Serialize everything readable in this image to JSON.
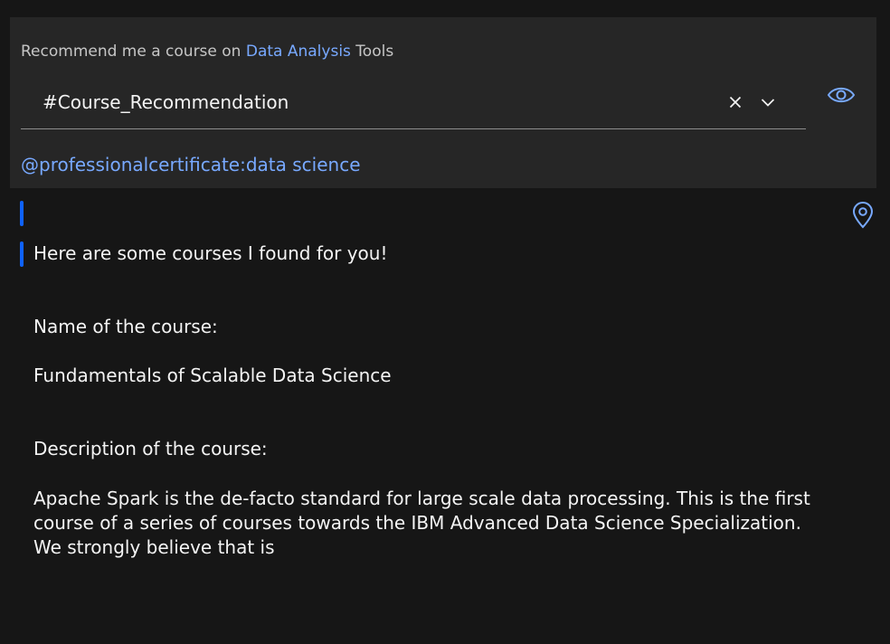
{
  "prompt": {
    "prefix": "Recommend me a course on ",
    "link": "Data Analysis",
    "suffix": " Tools"
  },
  "intent_field": {
    "value": "#Course_Recommendation"
  },
  "icons": {
    "clear": "close-icon",
    "chevron": "chevron-down-icon",
    "eye": "eye-icon",
    "pin": "location-pin-icon"
  },
  "entity_tag": "@professionalcertificate:data science",
  "response": {
    "intro": "Here are some courses I found for you!",
    "name_label": "Name of the course:",
    "name_value": "Fundamentals of Scalable Data Science",
    "description_label": "Description of the course:",
    "description_value": "Apache Spark is the de-facto standard for large scale data processing. This is the first course of a series of courses towards the IBM Advanced Data Science Specialization. We strongly believe that is"
  },
  "colors": {
    "background": "#161616",
    "panel": "#262626",
    "accent_link": "#78a9ff",
    "accent_bar": "#0f62fe",
    "text": "#f4f4f4",
    "muted": "#c6c6c6"
  }
}
